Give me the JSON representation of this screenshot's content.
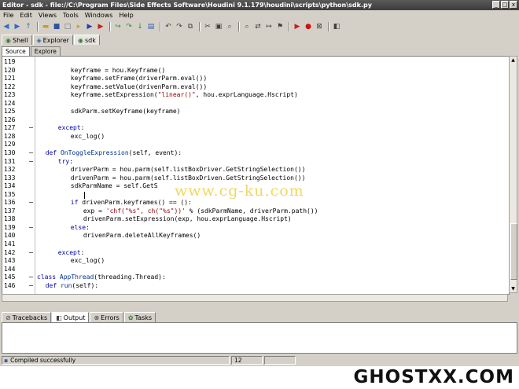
{
  "window": {
    "title": "Editor - sdk - file://C:\\Program Files\\Side Effects Software\\Houdini 9.1.179\\houdini\\scripts\\python\\sdk.py",
    "controls": [
      "_",
      "□",
      "x"
    ]
  },
  "menu": [
    "File",
    "Edit",
    "Views",
    "Tools",
    "Windows",
    "Help"
  ],
  "toolbar_icons": [
    "back-icon",
    "forward-icon",
    "up-icon",
    "folder-icon",
    "save-icon",
    "new-file-icon",
    "run-icon",
    "run-all-icon",
    "stop-icon",
    "step-icon",
    "step-over-icon",
    "step-into-icon",
    "doc-icon",
    "undo-icon",
    "redo-icon",
    "copy-icon",
    "cut-icon",
    "paste-icon",
    "find-icon",
    "find-next-icon",
    "replace-icon",
    "goto-icon",
    "bookmark-icon",
    "pause-icon",
    "record-icon",
    "clear-icon",
    "settings-icon"
  ],
  "panel_tabs": [
    {
      "label": "Shell",
      "icon": "shell-icon"
    },
    {
      "label": "Explorer",
      "icon": "explorer-icon"
    },
    {
      "label": "sdk",
      "icon": "python-icon"
    }
  ],
  "sub_tabs": [
    "Source",
    "Explore"
  ],
  "code_lines": [
    {
      "n": "119",
      "indent": 0,
      "parts": [],
      "fold": false
    },
    {
      "n": "120",
      "indent": 8,
      "parts": [
        [
          "",
          "keyframe = hou.Keyframe()"
        ]
      ],
      "fold": false
    },
    {
      "n": "121",
      "indent": 8,
      "parts": [
        [
          "",
          "keyframe.setFrame(driverParm.eval())"
        ]
      ],
      "fold": false
    },
    {
      "n": "122",
      "indent": 8,
      "parts": [
        [
          "",
          "keyframe.setValue(drivenParm.eval())"
        ]
      ],
      "fold": false
    },
    {
      "n": "123",
      "indent": 8,
      "parts": [
        [
          "",
          "keyframe.setExpression("
        ],
        [
          "str",
          "\"linear()\""
        ],
        [
          "",
          ", hou.exprLanguage.Hscript)"
        ]
      ],
      "fold": false
    },
    {
      "n": "124",
      "indent": 0,
      "parts": [],
      "fold": false
    },
    {
      "n": "125",
      "indent": 8,
      "parts": [
        [
          "",
          "sdkParm.setKeyframe(keyframe)"
        ]
      ],
      "fold": false
    },
    {
      "n": "126",
      "indent": 0,
      "parts": [],
      "fold": false
    },
    {
      "n": "127",
      "indent": 5,
      "parts": [
        [
          "kw",
          "except"
        ],
        [
          "",
          ":"
        ]
      ],
      "fold": true
    },
    {
      "n": "128",
      "indent": 8,
      "parts": [
        [
          "",
          "exc_log()"
        ]
      ],
      "fold": false
    },
    {
      "n": "129",
      "indent": 0,
      "parts": [],
      "fold": false
    },
    {
      "n": "130",
      "indent": 2,
      "parts": [
        [
          "kw",
          "def "
        ],
        [
          "fn",
          "OnToggleExpression"
        ],
        [
          "",
          "(self, event):"
        ]
      ],
      "fold": true
    },
    {
      "n": "131",
      "indent": 5,
      "parts": [
        [
          "kw",
          "try"
        ],
        [
          "",
          ":"
        ]
      ],
      "fold": true
    },
    {
      "n": "132",
      "indent": 8,
      "parts": [
        [
          "",
          "driverParm = hou.parm(self.listBoxDriver.GetStringSelection())"
        ]
      ],
      "fold": false
    },
    {
      "n": "133",
      "indent": 8,
      "parts": [
        [
          "",
          "drivenParm = hou.parm(self.listBoxDriven.GetStringSelection())"
        ]
      ],
      "fold": false
    },
    {
      "n": "134",
      "indent": 8,
      "parts": [
        [
          "",
          "sdkParmName = self.GetS"
        ]
      ],
      "fold": false
    },
    {
      "n": "135",
      "indent": 0,
      "parts": [],
      "fold": false
    },
    {
      "n": "136",
      "indent": 8,
      "parts": [
        [
          "kw",
          "if "
        ],
        [
          "",
          "drivenParm.keyframes() == ():"
        ]
      ],
      "fold": true
    },
    {
      "n": "137",
      "indent": 11,
      "parts": [
        [
          "",
          "exp = "
        ],
        [
          "str",
          "'chf(\"%s\", ch(\"%s\"))'"
        ],
        [
          "",
          " % (sdkParmName, driverParm.path())"
        ]
      ],
      "fold": false
    },
    {
      "n": "138",
      "indent": 11,
      "parts": [
        [
          "",
          "drivenParm.setExpression(exp, hou.exprLanguage.Hscript)"
        ]
      ],
      "fold": false
    },
    {
      "n": "139",
      "indent": 8,
      "parts": [
        [
          "kw",
          "else"
        ],
        [
          "",
          ":"
        ]
      ],
      "fold": true
    },
    {
      "n": "140",
      "indent": 11,
      "parts": [
        [
          "",
          "drivenParm.deleteAllKeyframes()"
        ]
      ],
      "fold": false
    },
    {
      "n": "141",
      "indent": 0,
      "parts": [],
      "fold": false
    },
    {
      "n": "142",
      "indent": 5,
      "parts": [
        [
          "kw",
          "except"
        ],
        [
          "",
          ":"
        ]
      ],
      "fold": true
    },
    {
      "n": "143",
      "indent": 8,
      "parts": [
        [
          "",
          "exc_log()"
        ]
      ],
      "fold": false
    },
    {
      "n": "144",
      "indent": 0,
      "parts": [],
      "fold": false
    },
    {
      "n": "145",
      "indent": 0,
      "parts": [
        [
          "kw",
          "class "
        ],
        [
          "fn",
          "AppThread"
        ],
        [
          "",
          "(threading.Thread):"
        ]
      ],
      "fold": true
    },
    {
      "n": "146",
      "indent": 2,
      "parts": [
        [
          "kw",
          "def "
        ],
        [
          "fn",
          "run"
        ],
        [
          "",
          "(self):"
        ]
      ],
      "fold": true
    }
  ],
  "bottom_tabs": [
    {
      "label": "Tracebacks",
      "icon": "traceback-icon"
    },
    {
      "label": "Output",
      "icon": "output-icon"
    },
    {
      "label": "Errors",
      "icon": "errors-icon"
    },
    {
      "label": "Tasks",
      "icon": "tasks-icon"
    }
  ],
  "status": {
    "message": "Compiled successfully",
    "line": "12"
  },
  "watermark": "www.cg-ku.com",
  "logo": "GHOSTXX.COM",
  "colors": {
    "keyword": "#0000b0",
    "string": "#900000",
    "fold": "#4a7a4a"
  }
}
